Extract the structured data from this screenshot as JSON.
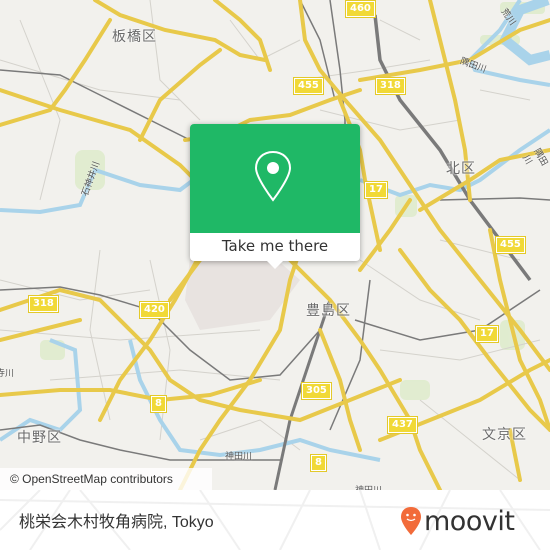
{
  "map": {
    "attribution": "© OpenStreetMap contributors",
    "colors": {
      "background": "#f2f1ed",
      "major_road": "#f3d95a",
      "river": "#a9d3ea",
      "rail": "#7a7a7a",
      "park": "#dcebc8"
    },
    "ward_labels": [
      {
        "text": "板橋区"
      },
      {
        "text": "北区"
      },
      {
        "text": "豊島区"
      },
      {
        "text": "中野区"
      },
      {
        "text": "文京区"
      }
    ],
    "river_labels": [
      {
        "text": "石神井川"
      },
      {
        "text": "隅田川"
      },
      {
        "text": "隅田川"
      },
      {
        "text": "荒川"
      },
      {
        "text": "神田川"
      },
      {
        "text": "神田川"
      },
      {
        "text": "妙正寺川"
      }
    ],
    "route_shields": [
      {
        "text": "460"
      },
      {
        "text": "455"
      },
      {
        "text": "318"
      },
      {
        "text": "17"
      },
      {
        "text": "455"
      },
      {
        "text": "318"
      },
      {
        "text": "420"
      },
      {
        "text": "17"
      },
      {
        "text": "305"
      },
      {
        "text": "8"
      },
      {
        "text": "437"
      },
      {
        "text": "8"
      }
    ]
  },
  "popup": {
    "button_label": "Take me there",
    "icon": "location-pin-icon",
    "accent_color": "#1fb866"
  },
  "footer": {
    "place_name": "桃栄会木村牧角病院, Tokyo",
    "logo_text": "moovit",
    "logo_color": "#f26b3a"
  }
}
